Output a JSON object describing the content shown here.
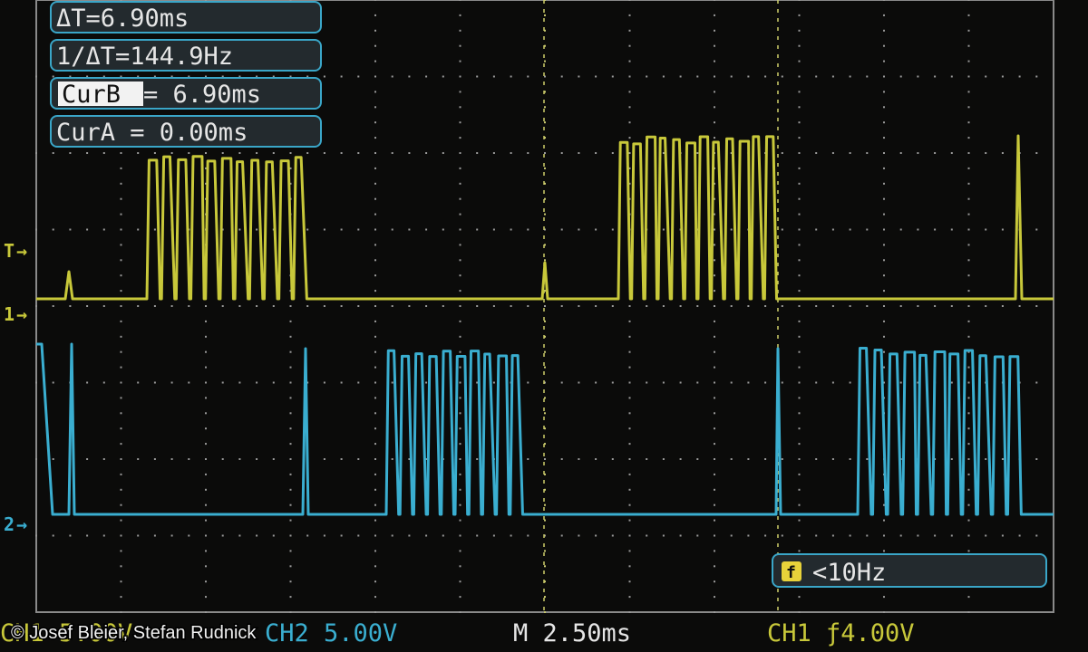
{
  "measurements": {
    "delta_t": "ΔT=6.90ms",
    "inv_delta_t": "1/ΔT=144.9Hz",
    "cur_b_label": "CurB",
    "cur_b_value": "= 6.90ms",
    "cur_a": "CurA = 0.00ms"
  },
  "markers": {
    "trigger": "T",
    "ch1": "1",
    "ch2": "2"
  },
  "frequency": {
    "icon": "f",
    "text": "<10Hz"
  },
  "status_bar": {
    "ch1_scale": "CH1 5.00V",
    "ch2_scale": "CH2 5.00V",
    "timebase": "M 2.50ms",
    "trigger": "CH1 ƒ4.00V"
  },
  "copyright": "© Josef Bleier, Stefan Rudnick",
  "colors": {
    "ch1": "#c8c83a",
    "ch2": "#3aaed0",
    "grid": "#9a9a9a",
    "panel_border": "#3aa6c8"
  }
}
